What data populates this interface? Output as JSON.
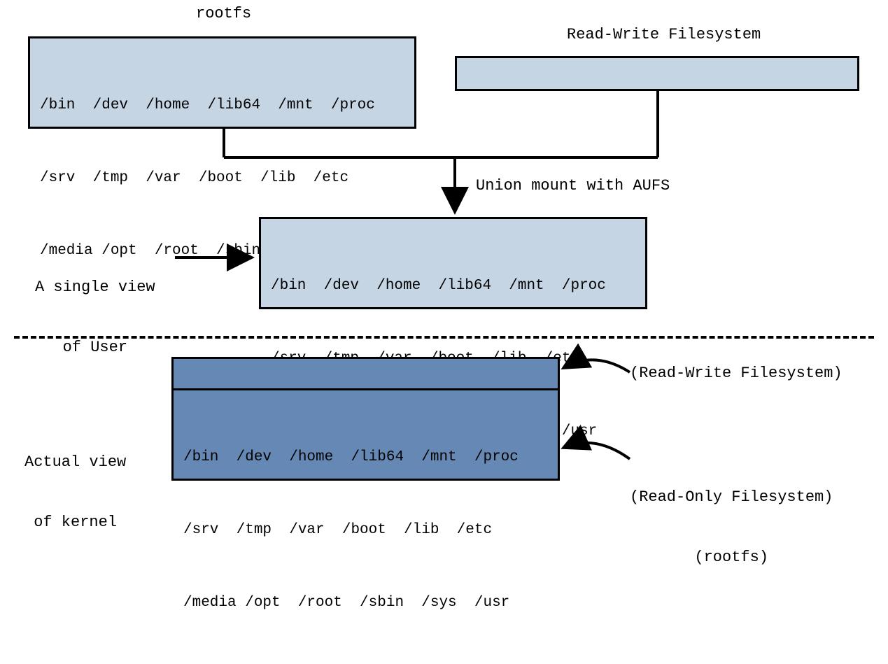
{
  "labels": {
    "rootfs_title": "rootfs",
    "rw_title": "Read-Write Filesystem",
    "union_caption": "Union mount with AUFS",
    "single_view_l1": "A single view",
    "single_view_l2": "of User",
    "actual_view_l1": "Actual view",
    "actual_view_l2": "of kernel",
    "kernel_rw_label": "(Read-Write Filesystem)",
    "kernel_ro_label_l1": "(Read-Only Filesystem)",
    "kernel_ro_label_l2": "(rootfs)"
  },
  "dirs": {
    "row1": "/bin  /dev  /home  /lib64  /mnt  /proc",
    "row2": "/srv  /tmp  /var  /boot  /lib  /etc",
    "row3": "/media /opt  /root  /sbin  /sys  /usr"
  },
  "colors": {
    "light_box": "#c5d5e4",
    "dark_box": "#6688b4",
    "border": "#000000"
  }
}
